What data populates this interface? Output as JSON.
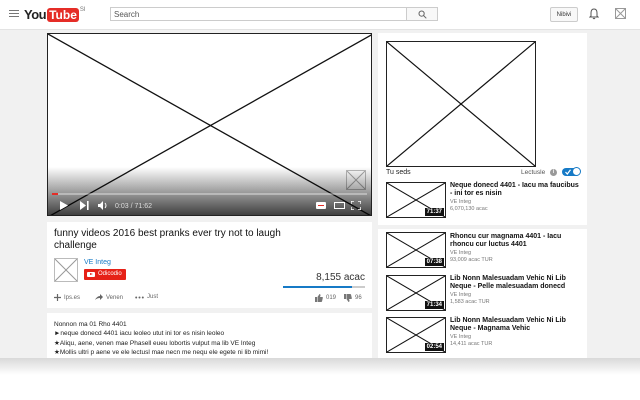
{
  "header": {
    "logo_you": "You",
    "logo_tube": "Tube",
    "logo_region": "SI",
    "search_placeholder": "Search",
    "signin_label": "Nibivi"
  },
  "player": {
    "time": "0:03 / 71:62",
    "progress_fraction": 0.02
  },
  "video": {
    "title": "funny videos 2016 best pranks ever try not to laugh challenge",
    "channel": "VE Integ",
    "subscribe_label": "Odicodio",
    "views": "8,155 acac",
    "like_fraction": 0.84,
    "action_add": "Ips.es",
    "action_share": "Venen",
    "action_more": "Just",
    "likes": "019",
    "dislikes": "96"
  },
  "description": {
    "lines": [
      "Nonnon ma 01 Rho 4401",
      "►neque donecd 4401 iacu leoleo utut ini tor es nisin leoleo",
      "★Aliqu, aene, venen mae Phasell eueu lobortis vulput ma lib VE Integ",
      "★Mollis ultri p aene ve ele lectusl mae necn me nequ ele egete ni lib mimi!"
    ]
  },
  "sidebar": {
    "up_next": "Tu seds",
    "autoplay": "Lectusle",
    "info": "i",
    "items": [
      {
        "title": "Neque donecd 4401 - Iacu ma faucibus - ini tor es nisin",
        "channel": "VE Integ",
        "views": "6,070,130 acac",
        "duration": "71:37"
      },
      {
        "title": "Rhoncu cur magnama 4401 - Iacu rhoncu cur luctus 4401",
        "channel": "VE Integ",
        "views": "93,009 acac   TUR",
        "duration": "07:38"
      },
      {
        "title": "Lib Nonn Malesuadam Vehic Ni Lib Neque - Pelle malesuadam donecd",
        "channel": "VE Integ",
        "views": "1,583 acac   TUR",
        "duration": "71:34"
      },
      {
        "title": "Lib Nonn Malesuadam Vehic Ni Lib Neque - Magnama Vehic",
        "channel": "VE Integ",
        "views": "14,411 acac   TUR",
        "duration": "02:54"
      }
    ]
  },
  "colors": {
    "brand_red": "#e52d27",
    "link_blue": "#167ac6"
  }
}
